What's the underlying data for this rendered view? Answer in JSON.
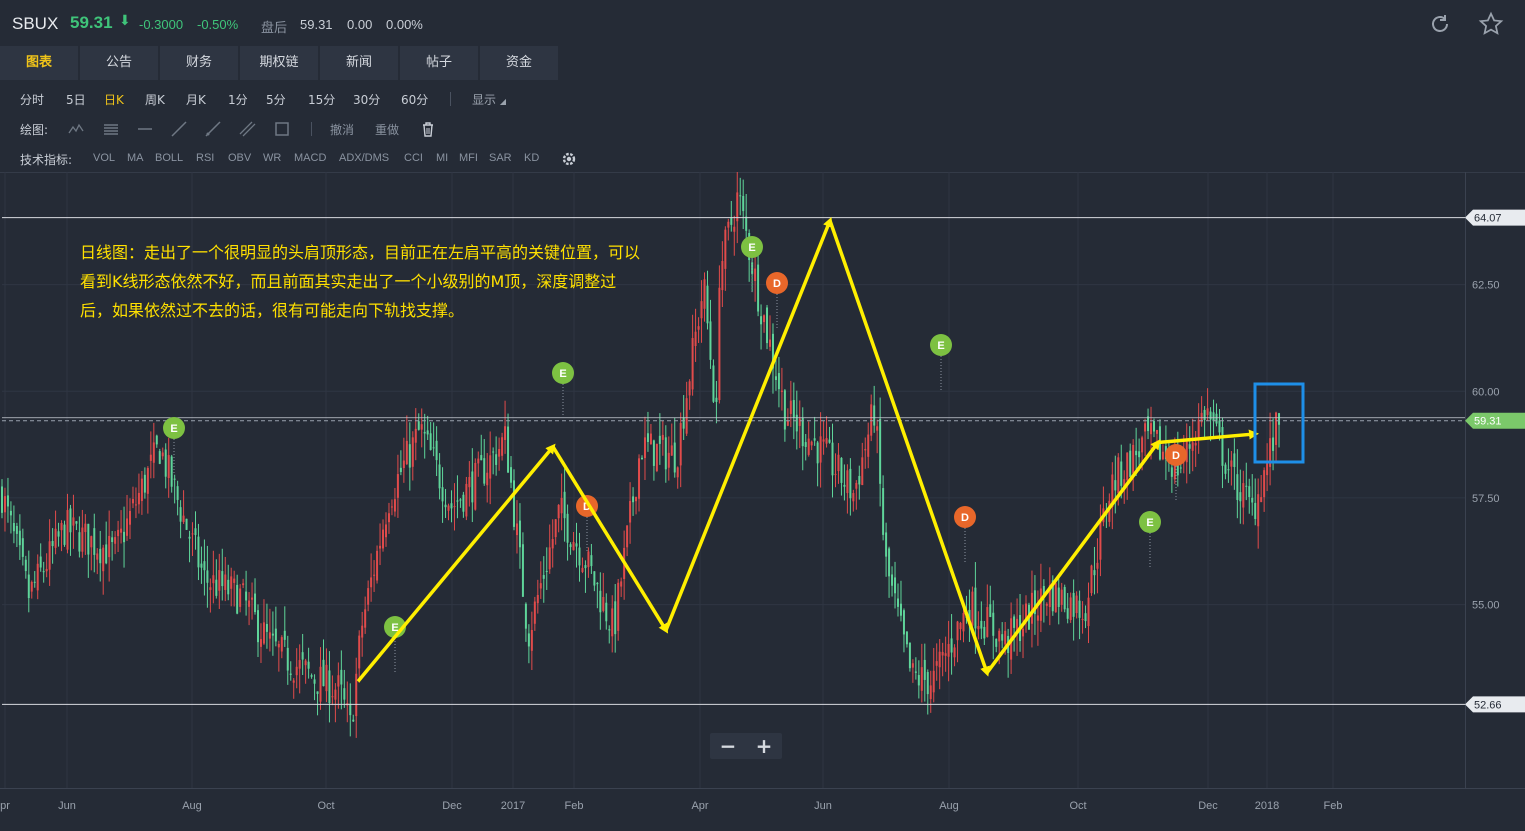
{
  "quote": {
    "symbol": "SBUX",
    "price": "59.31",
    "direction_icon": "down-arrow-icon",
    "change": "-0.3000",
    "change_pct": "-0.50%",
    "after_hours_label": "盘后",
    "after_hours_price": "59.31",
    "after_hours_change": "0.00",
    "after_hours_pct": "0.00%",
    "up_color": "#e14b4b",
    "down_color": "#3fc47a"
  },
  "tabs": [
    {
      "label": "图表",
      "active": true
    },
    {
      "label": "公告"
    },
    {
      "label": "财务"
    },
    {
      "label": "期权链"
    },
    {
      "label": "新闻"
    },
    {
      "label": "帖子"
    },
    {
      "label": "资金"
    }
  ],
  "periods": [
    {
      "label": "分时"
    },
    {
      "label": "5日"
    },
    {
      "label": "日K",
      "active": true
    },
    {
      "label": "周K"
    },
    {
      "label": "月K"
    },
    {
      "label": "1分"
    },
    {
      "label": "5分"
    },
    {
      "label": "15分"
    },
    {
      "label": "30分"
    },
    {
      "label": "60分"
    }
  ],
  "display_label": "显示",
  "drawing": {
    "label": "绘图:",
    "undo": "撤消",
    "redo": "重做"
  },
  "indicators": {
    "label": "技术指标:",
    "items": [
      "VOL",
      "MA",
      "BOLL",
      "RSI",
      "OBV",
      "WR",
      "MACD",
      "ADX/DMS",
      "CCI",
      "MI",
      "MFI",
      "SAR",
      "KD"
    ]
  },
  "chart_data": {
    "type": "candlestick",
    "y_ticks": [
      "62.50",
      "60.00",
      "57.50",
      "55.00"
    ],
    "x_ticks": [
      "pr",
      "Jun",
      "Aug",
      "Oct",
      "Dec",
      "2017",
      "Feb",
      "Apr",
      "Jun",
      "Aug",
      "Oct",
      "Dec",
      "2018",
      "Feb"
    ],
    "ylim": [
      50.7,
      65.0
    ],
    "resistance_level": "64.07",
    "support_level": "52.66",
    "current_level": "59.31",
    "events": [
      {
        "label": "E"
      },
      {
        "label": "E"
      },
      {
        "label": "D"
      },
      {
        "label": "E"
      },
      {
        "label": "D"
      },
      {
        "label": "E"
      },
      {
        "label": "D"
      },
      {
        "label": "D"
      },
      {
        "label": "E"
      },
      {
        "label": "E"
      }
    ],
    "trend_path": [
      53.2,
      53.9,
      58.7,
      54.4,
      64.0,
      53.4,
      58.8,
      59.0
    ],
    "annotation": "日线图：走出了一个很明显的头肩顶形态，目前正在左肩平高的关键位置，可以看到K线形态依然不好，而且前面其实走出了一个小级别的M顶，深度调整过后，如果依然过不去的话，很有可能走向下轨找支撑。"
  },
  "zoom": {
    "minus": "−",
    "plus": "+"
  }
}
